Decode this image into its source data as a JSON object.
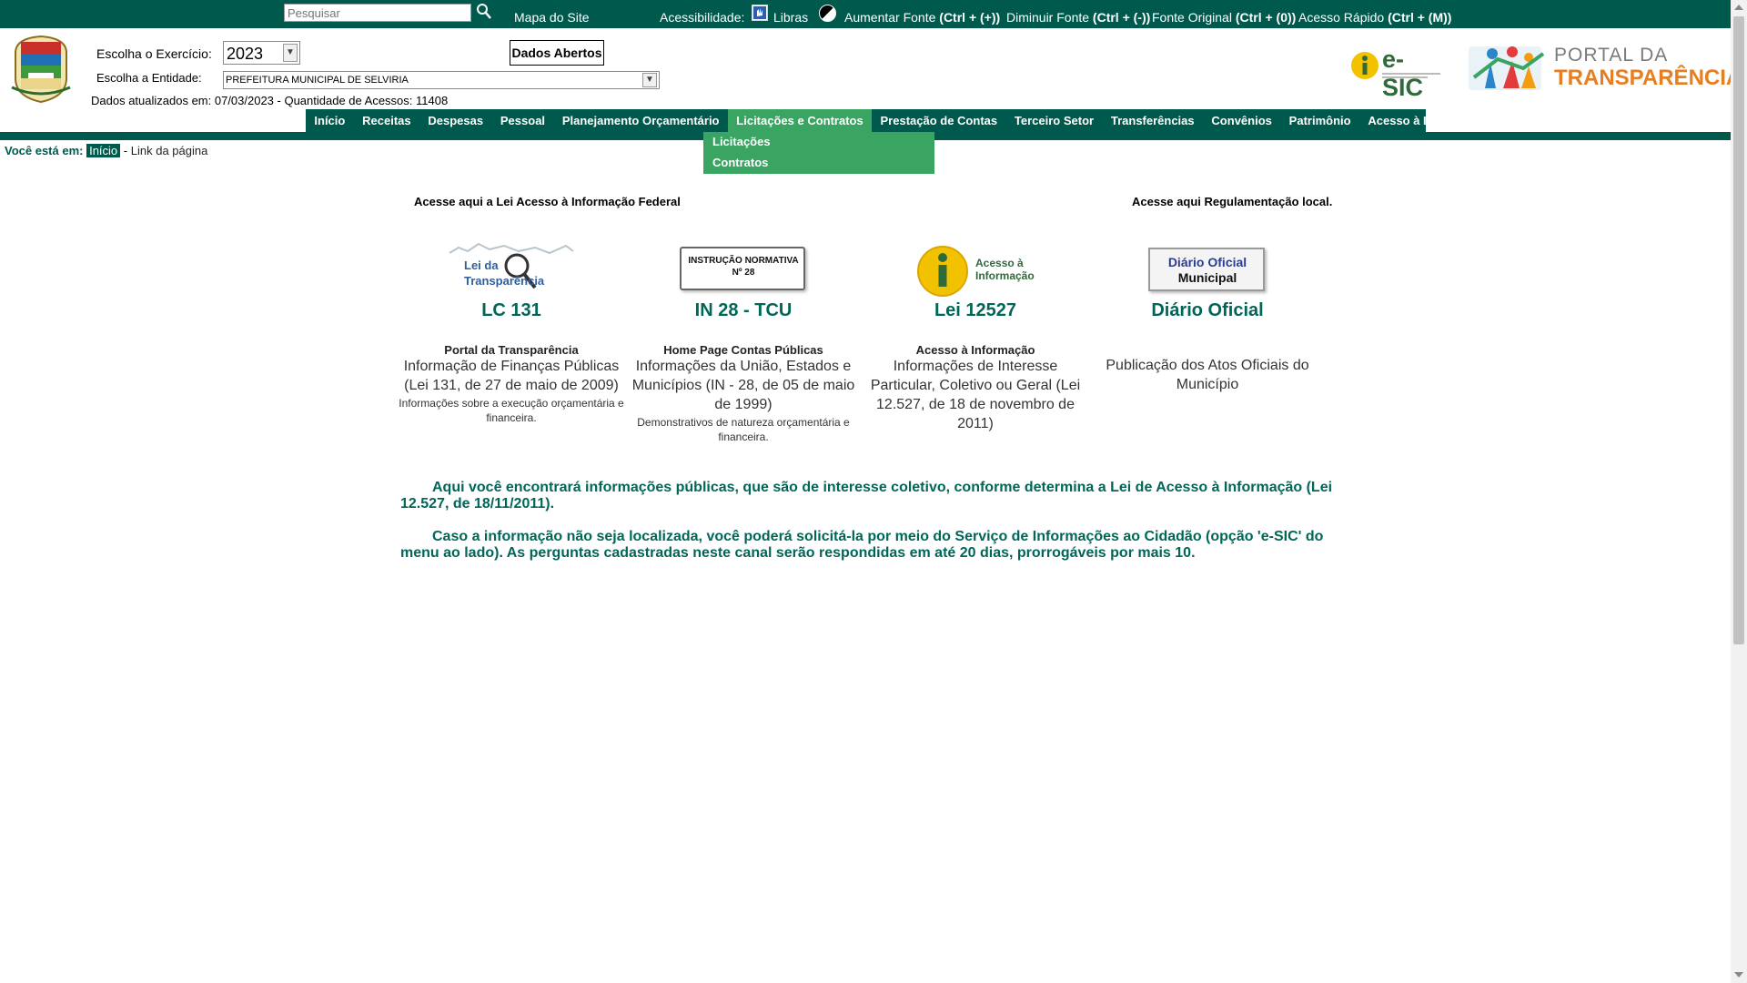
{
  "topbar": {
    "search_placeholder": "Pesquisar",
    "site_map": "Mapa do Site",
    "accessibility_label": "Acessibilidade:",
    "libras": "Libras",
    "increase_font": "Aumentar Fonte",
    "increase_font_key": "(Ctrl + (+))",
    "decrease_font": "Diminuir Fonte",
    "decrease_font_key": "(Ctrl + (-))",
    "original_font": "Fonte Original",
    "original_font_key": "(Ctrl + (0))",
    "quick_access": "Acesso Rápido",
    "quick_access_key": "(Ctrl + (M))"
  },
  "header": {
    "exercise_label": "Escolha o Exercício:",
    "exercise_value": "2023",
    "entity_label": "Escolha a Entidade:",
    "entity_value": "PREFEITURA MUNICIPAL DE SELVIRIA",
    "open_data_button": "Dados Abertos",
    "updated_info": "Dados atualizados em: 07/03/2023 - Quantidade de Acessos: 11408",
    "esic_logo_text": "e-SIC",
    "portal_logo_line1": "PORTAL DA",
    "portal_logo_line2": "TRANSPARÊNCIA"
  },
  "nav": {
    "items": [
      "Início",
      "Receitas",
      "Despesas",
      "Pessoal",
      "Planejamento Orçamentário",
      "Licitações e Contratos",
      "Prestação de Contas",
      "Terceiro Setor",
      "Transferências",
      "Convênios",
      "Patrimônio",
      "Acesso à Informação"
    ],
    "active_index": 5,
    "submenu": [
      "Licitações",
      "Contratos"
    ]
  },
  "breadcrumb": {
    "you_are_here": "Você está em:",
    "home": "Início",
    "separator": "-",
    "link": "Link da página"
  },
  "content": {
    "federal_link": "Acesse aqui a Lei Acesso à Informação Federal",
    "local_link": "Acesse aqui Regulamentação local.",
    "cards": [
      {
        "logo_text1": "Lei da",
        "logo_text2": "Transparência",
        "title": "LC 131",
        "subtitle": "Portal da Transparência",
        "description": "Informação de Finanças Públicas (Lei 131, de 27 de maio de 2009)",
        "small": "Informações sobre a execução orçamentária e financeira."
      },
      {
        "logo_text1": "INSTRUÇÃO NORMATIVA",
        "logo_text2": "Nº 28",
        "title": "IN 28 - TCU",
        "subtitle": "Home Page Contas Públicas",
        "description": "Informações da União, Estados e Municípios (IN - 28, de 05 de maio de 1999)",
        "small": "Demonstrativos de natureza orçamentária e financeira."
      },
      {
        "logo_text1": "Acesso à",
        "logo_text2": "Informação",
        "title": "Lei 12527",
        "subtitle": "Acesso à Informação",
        "description": "Informações de Interesse Particular, Coletivo ou Geral (Lei 12.527, de 18 de novembro de 2011)",
        "small": ""
      },
      {
        "logo_text1": "Diário Oficial",
        "logo_text2": "Municipal",
        "title": "Diário Oficial",
        "subtitle": "",
        "description": "Publicação dos Atos Oficiais do Município",
        "small": ""
      }
    ],
    "paragraph1": "Aqui você encontrará informações públicas, que são de interesse coletivo, conforme determina a Lei de Acesso à Informação (Lei 12.527, de 18/11/2011).",
    "paragraph2": "Caso a informação não seja localizada, você poderá solicitá-la por meio do Serviço de Informações ao Cidadão (opção 'e-SIC' do menu ao lado). As perguntas cadastradas neste canal serão respondidas em até 20 dias, prorrogáveis por mais 10."
  },
  "colors": {
    "primary_green": "#00594d",
    "active_green": "#3aa562",
    "title_teal": "#006658"
  }
}
